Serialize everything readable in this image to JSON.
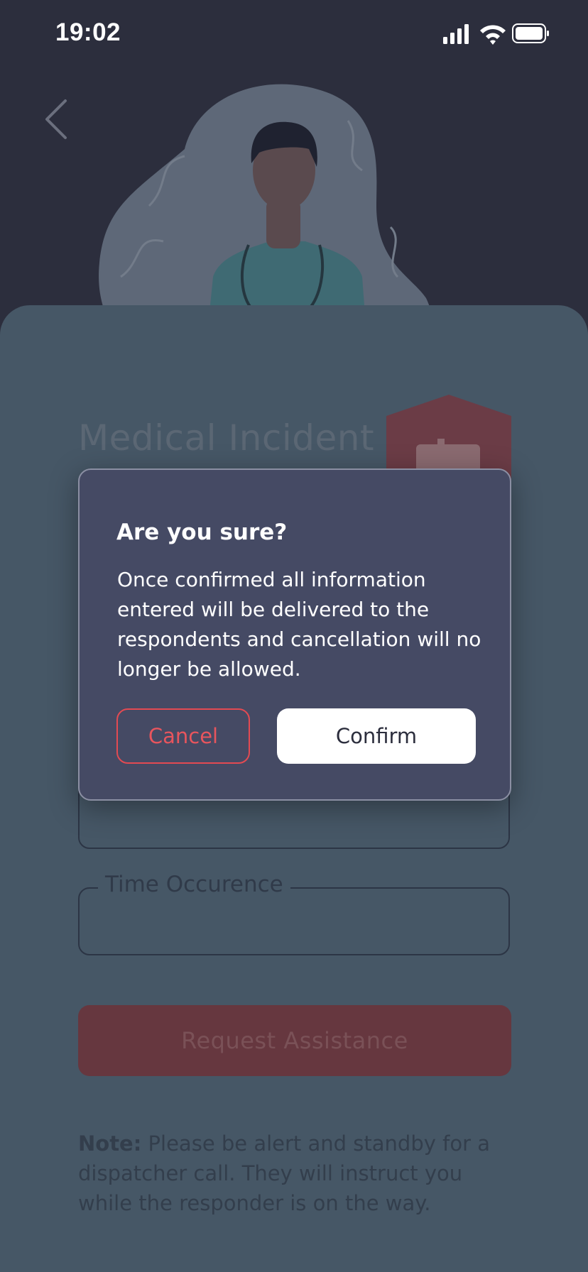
{
  "status_bar": {
    "time": "19:02"
  },
  "page": {
    "title": "Medical Incident",
    "fields": [
      {
        "label": ""
      },
      {
        "label": "Time Occurence"
      }
    ],
    "request_button": "Request Assistance",
    "note": {
      "label": "Note:",
      "text": "Please be alert and standby for a dispatcher call. They will instruct you while the responder is on the way."
    }
  },
  "dialog": {
    "title": "Are you sure?",
    "body": "Once confirmed all information entered will be delivered to the respondents and cancellation will no longer be allowed.",
    "cancel_label": "Cancel",
    "confirm_label": "Confirm"
  },
  "colors": {
    "header_bg": "#2c2e3d",
    "sheet_bg": "#465766",
    "dialog_bg": "#454a64",
    "accent_red": "#e34a52",
    "request_button_dimmed": "#66373f"
  }
}
